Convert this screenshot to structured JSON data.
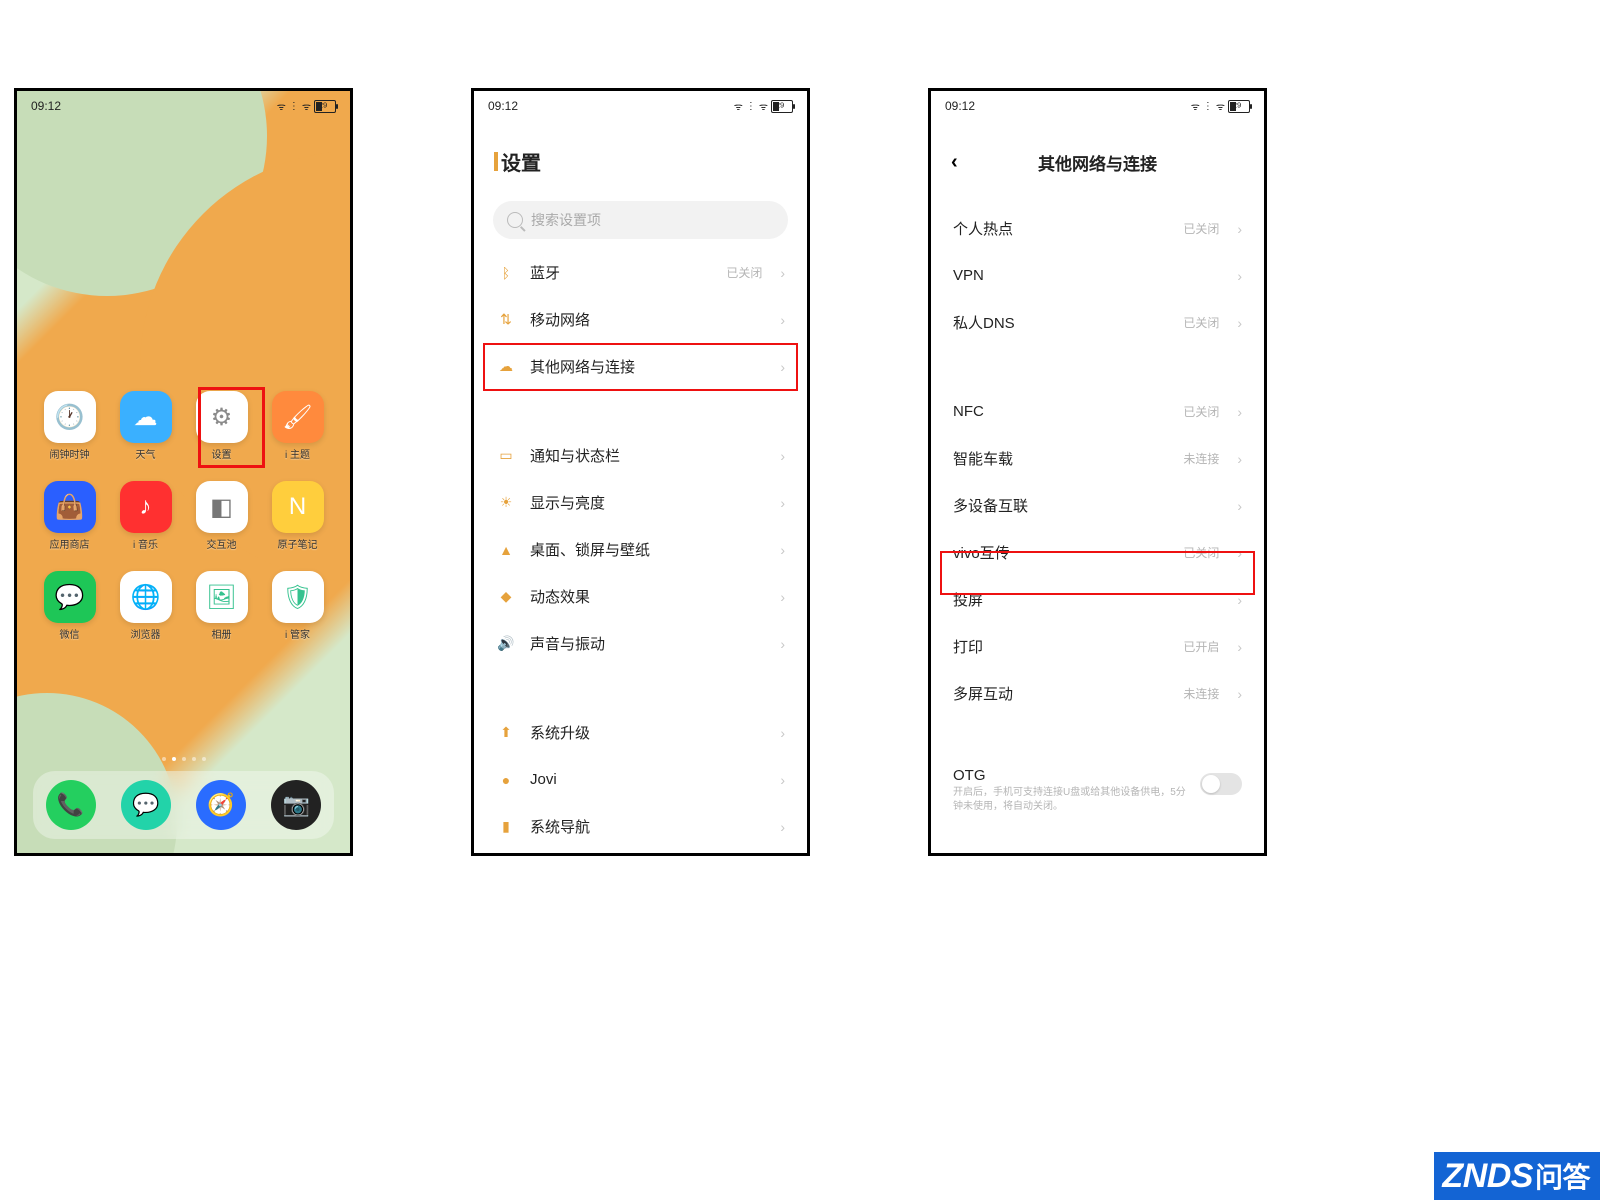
{
  "status": {
    "time": "09:12",
    "battery": "29"
  },
  "home": {
    "apps": [
      {
        "label": "闹钟时钟",
        "icon": "clock",
        "bg": "#fff",
        "fg": "#333"
      },
      {
        "label": "天气",
        "icon": "weather",
        "bg": "#3ab0ff",
        "fg": "#fff"
      },
      {
        "label": "设置",
        "icon": "gear",
        "bg": "#fff",
        "fg": "#8a8a8a"
      },
      {
        "label": "i 主题",
        "icon": "brush",
        "bg": "#ff8a3d",
        "fg": "#fff"
      },
      {
        "label": "应用商店",
        "icon": "bag",
        "bg": "#2a5fff",
        "fg": "#fff"
      },
      {
        "label": "i 音乐",
        "icon": "music",
        "bg": "#ff3030",
        "fg": "#fff"
      },
      {
        "label": "交互池",
        "icon": "cube",
        "bg": "#fff",
        "fg": "#777"
      },
      {
        "label": "原子笔记",
        "icon": "note",
        "bg": "#ffce3d",
        "fg": "#fff"
      },
      {
        "label": "微信",
        "icon": "wechat",
        "bg": "#1ec657",
        "fg": "#fff"
      },
      {
        "label": "浏览器",
        "icon": "globe",
        "bg": "#fff",
        "fg": "#2a6cff"
      },
      {
        "label": "相册",
        "icon": "gallery",
        "bg": "#fff",
        "fg": "#35c28f"
      },
      {
        "label": "i 管家",
        "icon": "shield",
        "bg": "#fff",
        "fg": "#35c28f"
      }
    ],
    "dock": [
      {
        "icon": "phone",
        "bg": "#24cf5f"
      },
      {
        "icon": "sms",
        "bg": "#22d3a9"
      },
      {
        "icon": "browser",
        "bg": "#2a6cff"
      },
      {
        "icon": "camera",
        "bg": "#222"
      }
    ]
  },
  "settings": {
    "title": "设置",
    "search_ph": "搜索设置项",
    "rows": [
      {
        "icon": "bt",
        "label": "蓝牙",
        "status": "已关闭",
        "fg": "#e6a23c"
      },
      {
        "icon": "sig",
        "label": "移动网络",
        "fg": "#e6a23c"
      },
      {
        "icon": "cloud",
        "label": "其他网络与连接",
        "fg": "#e6a23c"
      }
    ],
    "rows2": [
      {
        "icon": "bell",
        "label": "通知与状态栏",
        "fg": "#e6a23c"
      },
      {
        "icon": "sun",
        "label": "显示与亮度",
        "fg": "#e6a23c"
      },
      {
        "icon": "home",
        "label": "桌面、锁屏与壁纸",
        "fg": "#e6a23c"
      },
      {
        "icon": "diamond",
        "label": "动态效果",
        "fg": "#e6a23c"
      },
      {
        "icon": "sound",
        "label": "声音与振动",
        "fg": "#e6a23c"
      }
    ],
    "rows3": [
      {
        "icon": "up",
        "label": "系统升级",
        "fg": "#e6a23c"
      },
      {
        "icon": "jovi",
        "label": "Jovi",
        "fg": "#e6a23c"
      },
      {
        "icon": "nav",
        "label": "系统导航",
        "fg": "#e6a23c"
      }
    ]
  },
  "network": {
    "title": "其他网络与连接",
    "rows": [
      {
        "label": "个人热点",
        "status": "已关闭"
      },
      {
        "label": "VPN"
      },
      {
        "label": "私人DNS",
        "status": "已关闭"
      }
    ],
    "rows2": [
      {
        "label": "NFC",
        "status": "已关闭"
      },
      {
        "label": "智能车载",
        "status": "未连接"
      },
      {
        "label": "多设备互联"
      },
      {
        "label": "vivo互传",
        "status": "已关闭"
      },
      {
        "label": "投屏"
      },
      {
        "label": "打印",
        "status": "已开启"
      },
      {
        "label": "多屏互动",
        "status": "未连接"
      }
    ],
    "otg": {
      "label": "OTG",
      "desc": "开启后，手机可支持连接U盘或给其他设备供电，5分钟未使用，将自动关闭。"
    }
  },
  "watermark": {
    "en": "ZNDS",
    "zh": "问答"
  },
  "glyphs": {
    "clock": "🕐",
    "weather": "☁",
    "gear": "⚙",
    "brush": "🖌",
    "bag": "👜",
    "music": "♪",
    "cube": "◧",
    "note": "N",
    "wechat": "💬",
    "globe": "🌐",
    "gallery": "🖼",
    "shield": "🛡",
    "phone": "📞",
    "sms": "💬",
    "browser": "🧭",
    "camera": "📷",
    "bt": "ᛒ",
    "sig": "⇅",
    "cloud": "☁",
    "bell": "▭",
    "sun": "☀",
    "home": "▲",
    "diamond": "◆",
    "sound": "🔊",
    "up": "⬆",
    "jovi": "●",
    "nav": "▮"
  }
}
